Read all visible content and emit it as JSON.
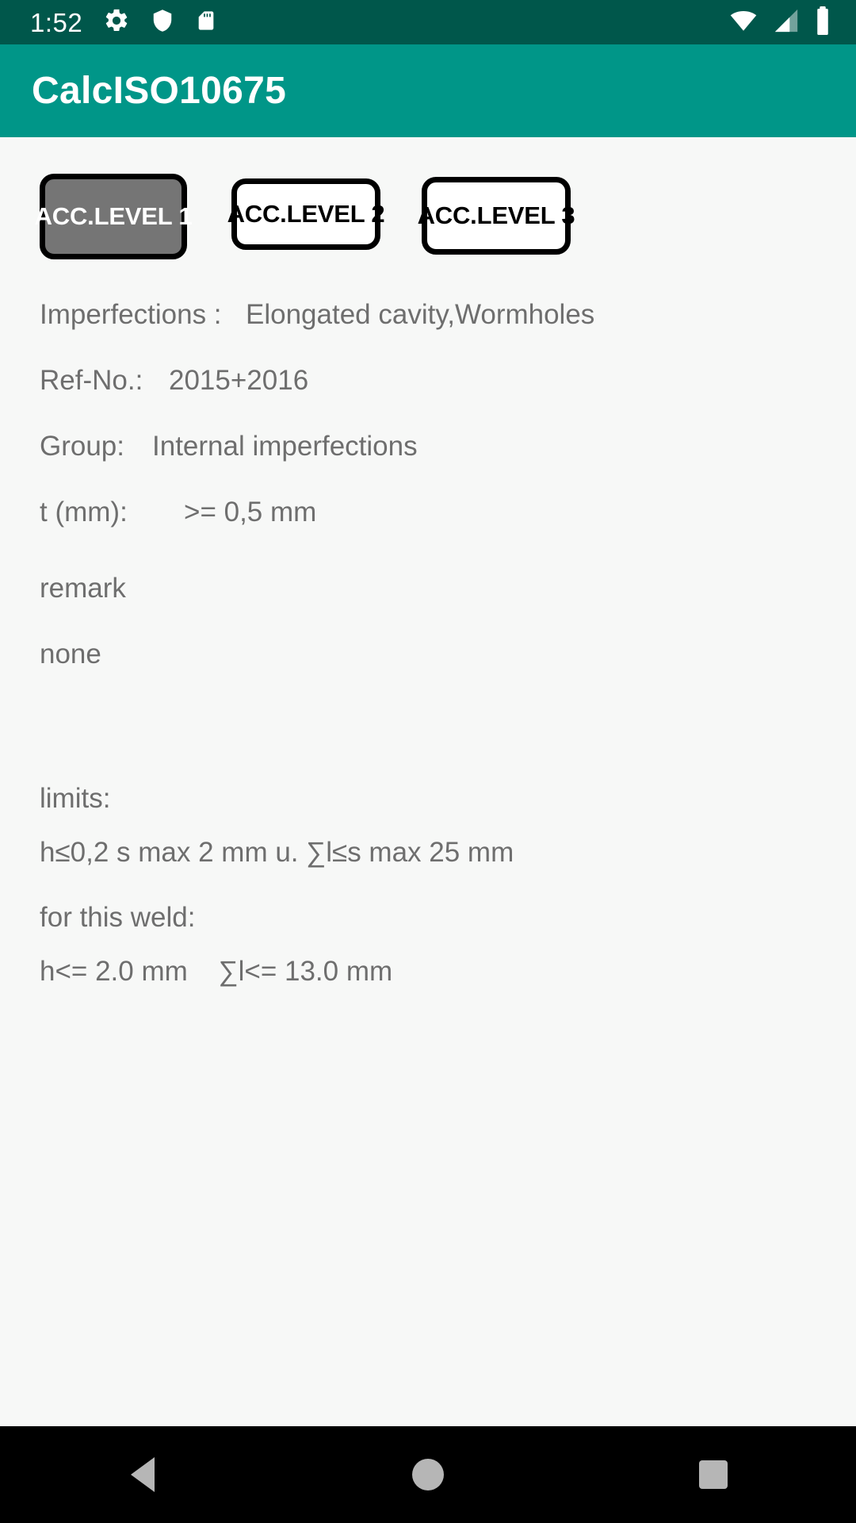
{
  "status_bar": {
    "time": "1:52",
    "icons_left": [
      "gear-icon",
      "shield-icon",
      "sd-card-icon"
    ],
    "icons_right": [
      "wifi-icon",
      "cellular-signal-icon",
      "battery-icon"
    ],
    "background_color": "#00574B"
  },
  "app_bar": {
    "title": "CalcISO10675",
    "background_color": "#009688",
    "text_color": "#ffffff"
  },
  "levels": {
    "buttons": [
      {
        "label": "ACC.LEVEL 1",
        "selected": true
      },
      {
        "label": "ACC.LEVEL 2",
        "selected": false
      },
      {
        "label": "ACC.LEVEL 3",
        "selected": false
      }
    ],
    "selected_fill": "#757575",
    "selected_text": "#ffffff",
    "border_color": "#000000"
  },
  "details": {
    "imperfections_label": "Imperfections :",
    "imperfections_value": "Elongated cavity,Wormholes",
    "refno_label": "Ref-No.:",
    "refno_value": "2015+2016",
    "group_label": "Group:",
    "group_value": "Internal imperfections",
    "thickness_label": "t (mm):",
    "thickness_value": ">= 0,5 mm"
  },
  "remark": {
    "title": "remark",
    "text": "none"
  },
  "limits": {
    "title": "limits:",
    "formula": "h≤0,2 s max 2 mm u. ∑l≤s max 25 mm",
    "weld_title": "for this weld:",
    "weld_values": "h<= 2.0 mm    ∑l<= 13.0 mm"
  },
  "nav_bar": {
    "back": "back-button",
    "home": "home-button",
    "recents": "recents-button"
  }
}
